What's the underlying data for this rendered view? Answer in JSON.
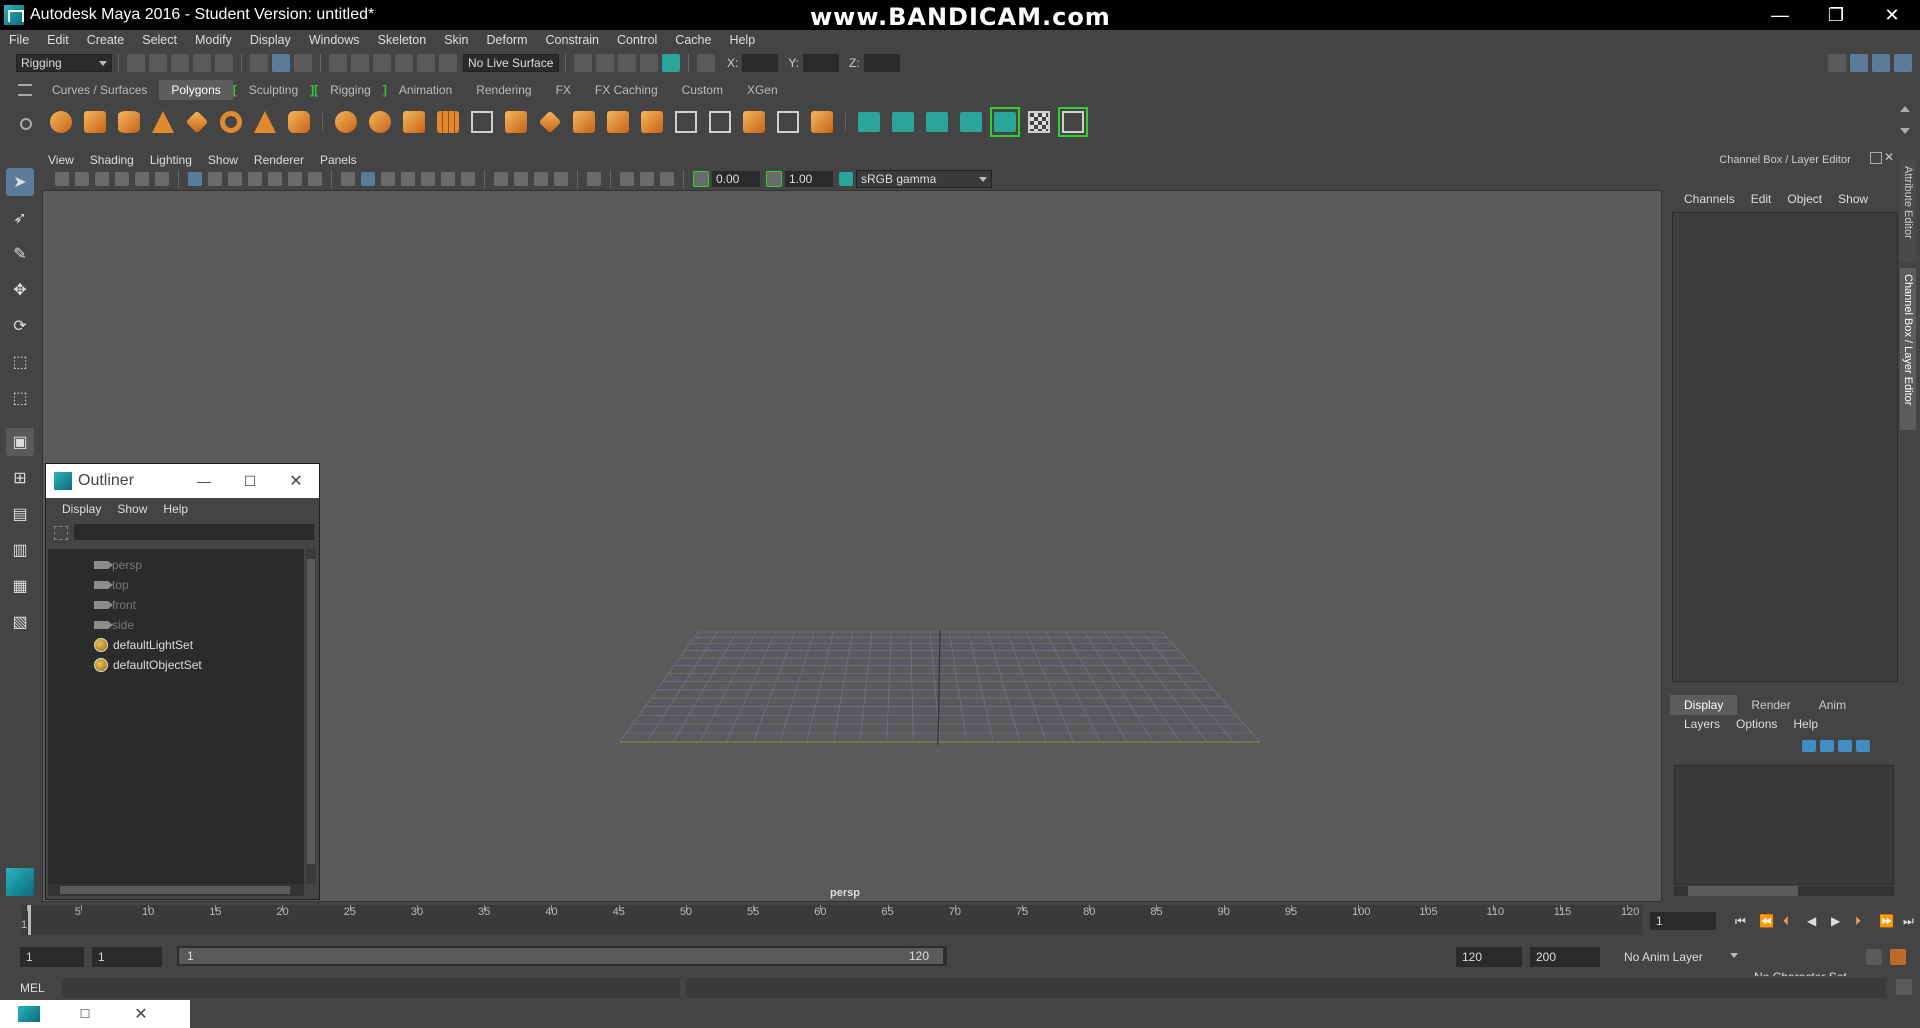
{
  "window": {
    "title": "Autodesk Maya 2016 - Student Version: untitled*",
    "watermark": "www.BANDICAM.com",
    "controls": {
      "minimize": "—",
      "restore": "❐",
      "close": "✕"
    }
  },
  "menubar": [
    "File",
    "Edit",
    "Create",
    "Select",
    "Modify",
    "Display",
    "Windows",
    "Skeleton",
    "Skin",
    "Deform",
    "Constrain",
    "Control",
    "Cache",
    "Help"
  ],
  "statusline": {
    "menuset": "Rigging",
    "live_surface": "No Live Surface",
    "x_label": "X:",
    "y_label": "Y:",
    "z_label": "Z:"
  },
  "shelf": {
    "tabs": [
      "Curves / Surfaces",
      "Polygons",
      "Sculpting",
      "Rigging",
      "Animation",
      "Rendering",
      "FX",
      "FX Caching",
      "Custom",
      "XGen"
    ],
    "active_tab": "Polygons"
  },
  "viewport": {
    "menu": [
      "View",
      "Shading",
      "Lighting",
      "Show",
      "Renderer",
      "Panels"
    ],
    "exposure": "0.00",
    "gamma": "1.00",
    "colorspace": "sRGB gamma",
    "camera_label": "persp"
  },
  "channel_box": {
    "title": "Channel Box / Layer Editor",
    "menu": [
      "Channels",
      "Edit",
      "Object",
      "Show"
    ],
    "layer_tabs": [
      "Display",
      "Render",
      "Anim"
    ],
    "layer_menu": [
      "Layers",
      "Options",
      "Help"
    ],
    "side_tabs": [
      "Attribute Editor",
      "Channel Box / Layer Editor"
    ]
  },
  "outliner": {
    "title": "Outliner",
    "menu": [
      "Display",
      "Show",
      "Help"
    ],
    "items": [
      {
        "label": "persp",
        "type": "camera",
        "dim": true
      },
      {
        "label": "top",
        "type": "camera",
        "dim": true
      },
      {
        "label": "front",
        "type": "camera",
        "dim": true
      },
      {
        "label": "side",
        "type": "camera",
        "dim": true
      },
      {
        "label": "defaultLightSet",
        "type": "set",
        "dim": false
      },
      {
        "label": "defaultObjectSet",
        "type": "set",
        "dim": false
      }
    ]
  },
  "timeline": {
    "ticks": [
      1,
      5,
      10,
      15,
      20,
      25,
      30,
      35,
      40,
      45,
      50,
      55,
      60,
      65,
      70,
      75,
      80,
      85,
      90,
      95,
      100,
      105,
      110,
      115,
      120
    ],
    "current_frame": "1"
  },
  "range": {
    "start": "1",
    "playback_start": "1",
    "slider_start": "1",
    "slider_end": "120",
    "playback_end": "120",
    "end": "200",
    "anim_layer": "No Anim Layer",
    "character_set": "No Character Set"
  },
  "command": {
    "label": "MEL"
  },
  "colors": {
    "background": "#444444",
    "viewport": "#5a5a5a",
    "accent_green": "#35c835",
    "accent_blue": "#5b7c99"
  }
}
